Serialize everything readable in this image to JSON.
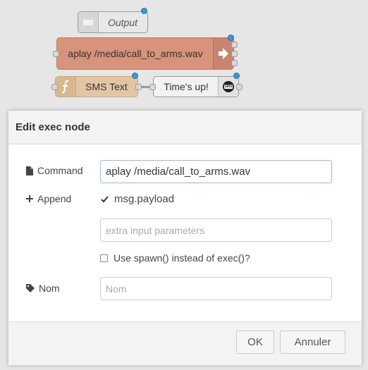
{
  "flow": {
    "nodes": {
      "output": "Output",
      "exec": "aplay /media/call_to_arms.wav",
      "function": "SMS Text",
      "sms": "Time's up!"
    },
    "sms_icon_text": "SMS"
  },
  "dialog": {
    "title": "Edit exec node",
    "command_label": "Command",
    "command_value": "aplay /media/call_to_arms.wav",
    "append_label": "Append",
    "append_checkbox_label": "msg.payload",
    "append_checked": true,
    "extra_placeholder": "extra input parameters",
    "spawn_label": "Use spawn() instead of exec()?",
    "spawn_checked": false,
    "name_label": "Nom",
    "name_placeholder": "Nom",
    "ok_label": "OK",
    "cancel_label": "Annuler"
  },
  "colors": {
    "exec_node": "#d7937b",
    "function_node": "#e2c6a4",
    "output_node": "#e8e8e8",
    "sms_node": "#f2f2f2",
    "changed_dot": "#3a9ad9"
  }
}
